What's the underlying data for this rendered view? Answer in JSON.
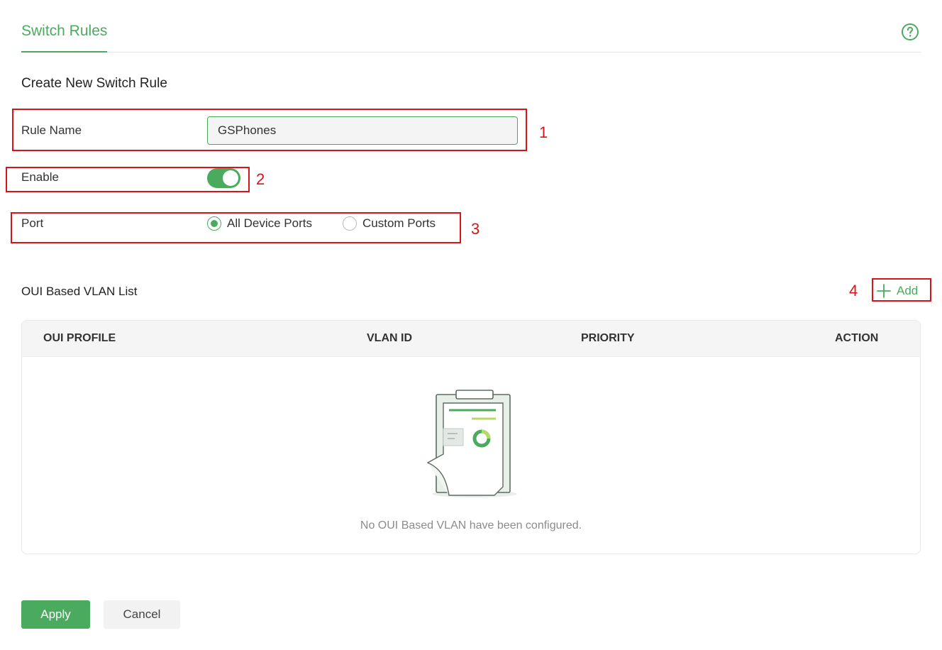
{
  "header": {
    "tab_label": "Switch Rules",
    "help_icon": "question-circle-icon",
    "accent_color": "#4aab5e"
  },
  "form": {
    "section_title": "Create New Switch Rule",
    "rule_name_label": "Rule Name",
    "rule_name_value": "GSPhones",
    "enable_label": "Enable",
    "enable_on": true,
    "port_label": "Port",
    "port_options": [
      {
        "label": "All Device Ports",
        "selected": true
      },
      {
        "label": "Custom Ports",
        "selected": false
      }
    ]
  },
  "vlan_list": {
    "title": "OUI Based VLAN List",
    "add_label": "Add",
    "columns": [
      "OUI PROFILE",
      "VLAN ID",
      "PRIORITY",
      "ACTION"
    ],
    "rows": [],
    "empty_message": "No OUI Based VLAN have been configured.",
    "empty_icon": "clipboard-chart-icon"
  },
  "annotations": {
    "color": "#d7141a",
    "labels": [
      "1",
      "2",
      "3",
      "4"
    ]
  },
  "actions": {
    "apply_label": "Apply",
    "cancel_label": "Cancel"
  }
}
